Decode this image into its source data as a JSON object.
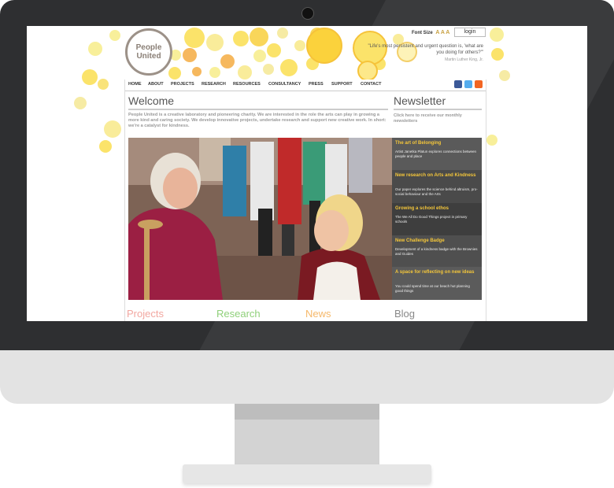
{
  "site": {
    "logo": {
      "line1": "People",
      "line2": "United"
    },
    "font_size_label": "Font Size",
    "font_size_glyphs": "A A A",
    "login_label": "login",
    "quote": "\"Life's most persistent and urgent question is, 'what are you doing for others?'\"",
    "quote_author": "Martin Luther King, Jr."
  },
  "nav": {
    "items": [
      "HOME",
      "ABOUT",
      "PROJECTS",
      "RESEARCH",
      "RESOURCES",
      "CONSULTANCY",
      "PRESS",
      "SUPPORT",
      "CONTACT"
    ]
  },
  "welcome": {
    "title": "Welcome",
    "text": "People United is a creative laboratory and pioneering charity. We are interested in the role the arts can play in growing a more kind and caring society. We develop innovative projects, undertake research and support new creative work. In short: we're a catalyst for kindness."
  },
  "newsletter": {
    "title": "Newsletter",
    "text": "Click here to receive our monthly newsletters"
  },
  "sidebar": {
    "items": [
      {
        "title": "The art of Belonging",
        "desc": "Artist Janetka Platun explores connections between people and place"
      },
      {
        "title": "New research on Arts and Kindness",
        "desc": "Our paper explores the science behind altruism, pro-social behaviour and the Arts"
      },
      {
        "title": "Growing a school ethos",
        "desc": "The We All Do Good Things project in primary schools"
      },
      {
        "title": "New Challenge Badge",
        "desc": "Development of a kindness badge with the Brownies and Guides"
      },
      {
        "title": "A space for reflecting on new ideas",
        "desc": "You could spend time at our beach hut planning good things"
      }
    ]
  },
  "bottom": {
    "projects": "Projects",
    "research": "Research",
    "news": "News",
    "blog": "Blog"
  },
  "colors": {
    "accent_yellow": "#f4c63a",
    "projects": "#f2a7a0",
    "research": "#8fd07a",
    "news": "#f6b86a",
    "blog": "#888888"
  }
}
